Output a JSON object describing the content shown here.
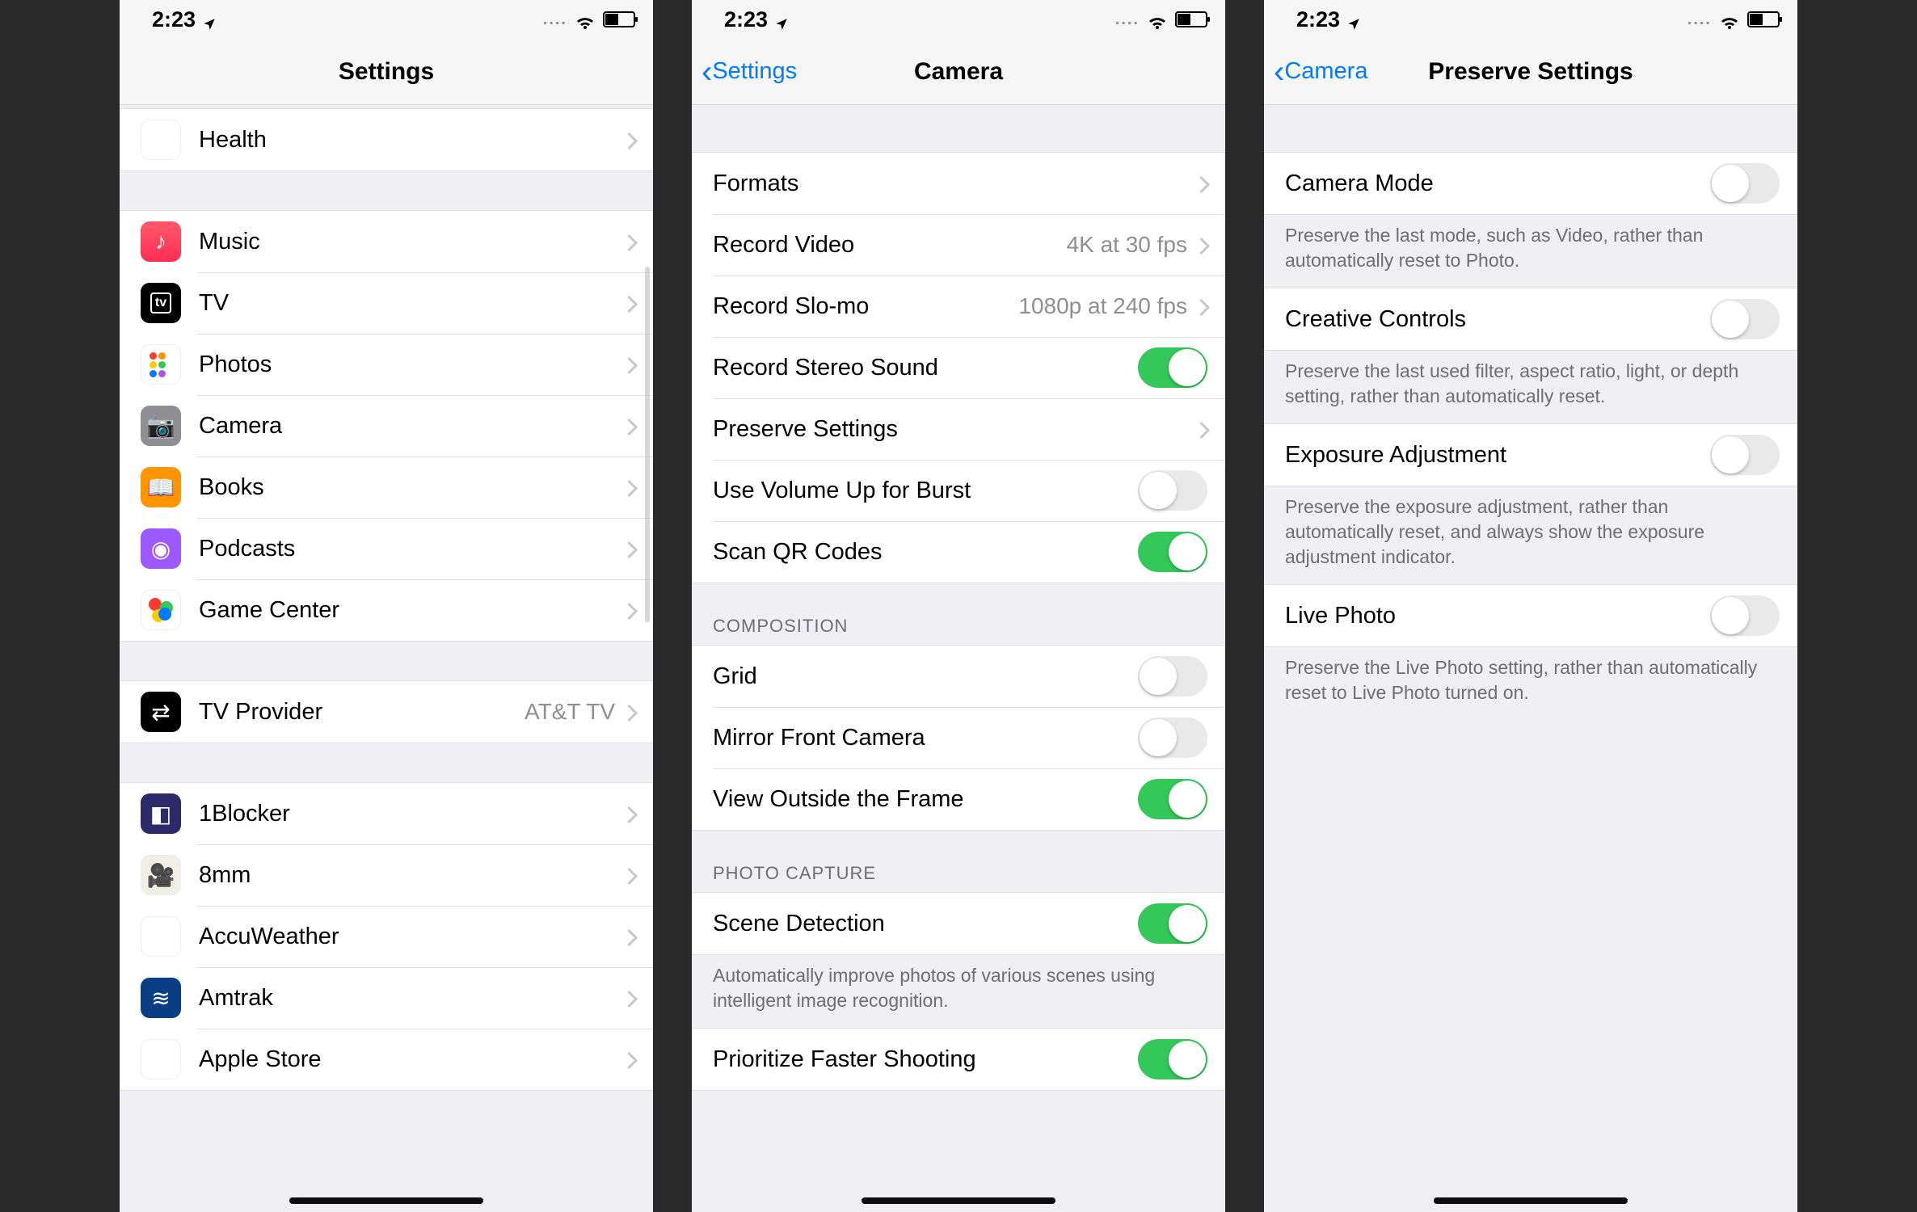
{
  "status": {
    "time": "2:23",
    "dots": "....",
    "battery_level_pct": 45
  },
  "panels": [
    {
      "nav": {
        "title": "Settings",
        "back": null
      },
      "groups": [
        {
          "items": [
            {
              "id": "health",
              "icon": "ic-health",
              "glyph": "♥",
              "label": "Health",
              "kind": "drill"
            }
          ]
        },
        {
          "items": [
            {
              "id": "music",
              "icon": "ic-music",
              "glyph": "♪",
              "label": "Music",
              "kind": "drill"
            },
            {
              "id": "tv",
              "icon": "ic-tv",
              "glyph": "tv",
              "label": "TV",
              "kind": "drill"
            },
            {
              "id": "photos",
              "icon": "ic-photos",
              "glyph": "photos",
              "label": "Photos",
              "kind": "drill"
            },
            {
              "id": "camera",
              "icon": "ic-camera",
              "glyph": "📷",
              "label": "Camera",
              "kind": "drill"
            },
            {
              "id": "books",
              "icon": "ic-books",
              "glyph": "📖",
              "label": "Books",
              "kind": "drill"
            },
            {
              "id": "podcasts",
              "icon": "ic-podcasts",
              "glyph": "◉",
              "label": "Podcasts",
              "kind": "drill"
            },
            {
              "id": "gamecenter",
              "icon": "ic-gamecenter",
              "glyph": "gc",
              "label": "Game Center",
              "kind": "drill"
            }
          ]
        },
        {
          "items": [
            {
              "id": "tvprovider",
              "icon": "ic-tvprovider",
              "glyph": "⇄",
              "label": "TV Provider",
              "kind": "drill",
              "value": "AT&T TV"
            }
          ]
        },
        {
          "items": [
            {
              "id": "1blocker",
              "icon": "ic-1blocker",
              "glyph": "◧",
              "label": "1Blocker",
              "kind": "drill"
            },
            {
              "id": "8mm",
              "icon": "ic-8mm",
              "glyph": "🎥",
              "label": "8mm",
              "kind": "drill"
            },
            {
              "id": "accuweather",
              "icon": "ic-accuweather",
              "glyph": "☀",
              "label": "AccuWeather",
              "kind": "drill"
            },
            {
              "id": "amtrak",
              "icon": "ic-amtrak",
              "glyph": "≋",
              "label": "Amtrak",
              "kind": "drill"
            },
            {
              "id": "applestore",
              "icon": "ic-applestore",
              "glyph": "🛍",
              "label": "Apple Store",
              "kind": "drill"
            }
          ]
        }
      ]
    },
    {
      "nav": {
        "title": "Camera",
        "back": "Settings"
      },
      "sections": [
        {
          "header": null,
          "items": [
            {
              "id": "formats",
              "label": "Formats",
              "kind": "drill"
            },
            {
              "id": "record-video",
              "label": "Record Video",
              "kind": "drill",
              "value": "4K at 30 fps"
            },
            {
              "id": "record-slomo",
              "label": "Record Slo-mo",
              "kind": "drill",
              "value": "1080p at 240 fps"
            },
            {
              "id": "stereo-sound",
              "label": "Record Stereo Sound",
              "kind": "switch",
              "on": true
            },
            {
              "id": "preserve-settings",
              "label": "Preserve Settings",
              "kind": "drill"
            },
            {
              "id": "volume-burst",
              "label": "Use Volume Up for Burst",
              "kind": "switch",
              "on": false
            },
            {
              "id": "scan-qr",
              "label": "Scan QR Codes",
              "kind": "switch",
              "on": true
            }
          ],
          "footer": null
        },
        {
          "header": "COMPOSITION",
          "items": [
            {
              "id": "grid",
              "label": "Grid",
              "kind": "switch",
              "on": false
            },
            {
              "id": "mirror-front",
              "label": "Mirror Front Camera",
              "kind": "switch",
              "on": false
            },
            {
              "id": "view-outside",
              "label": "View Outside the Frame",
              "kind": "switch",
              "on": true
            }
          ],
          "footer": null
        },
        {
          "header": "PHOTO CAPTURE",
          "items": [
            {
              "id": "scene-detection",
              "label": "Scene Detection",
              "kind": "switch",
              "on": true
            }
          ],
          "footer": "Automatically improve photos of various scenes using intelligent image recognition."
        },
        {
          "header": null,
          "items": [
            {
              "id": "faster-shooting",
              "label": "Prioritize Faster Shooting",
              "kind": "switch",
              "on": true
            }
          ],
          "footer": null
        }
      ]
    },
    {
      "nav": {
        "title": "Preserve Settings",
        "back": "Camera"
      },
      "sections": [
        {
          "items": [
            {
              "id": "camera-mode",
              "label": "Camera Mode",
              "kind": "switch",
              "on": false
            }
          ],
          "footer": "Preserve the last mode, such as Video, rather than automatically reset to Photo."
        },
        {
          "items": [
            {
              "id": "creative-controls",
              "label": "Creative Controls",
              "kind": "switch",
              "on": false
            }
          ],
          "footer": "Preserve the last used filter, aspect ratio, light, or depth setting, rather than automatically reset."
        },
        {
          "items": [
            {
              "id": "exposure-adjustment",
              "label": "Exposure Adjustment",
              "kind": "switch",
              "on": false
            }
          ],
          "footer": "Preserve the exposure adjustment, rather than automatically reset, and always show the exposure adjustment indicator."
        },
        {
          "items": [
            {
              "id": "live-photo",
              "label": "Live Photo",
              "kind": "switch",
              "on": false
            }
          ],
          "footer": "Preserve the Live Photo setting, rather than automatically reset to Live Photo turned on."
        }
      ]
    }
  ]
}
